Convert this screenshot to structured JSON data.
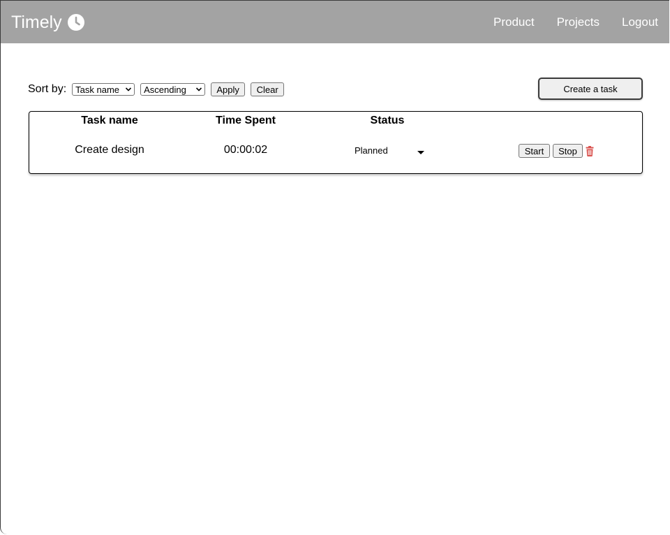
{
  "nav": {
    "brand": "Timely",
    "links": [
      "Product",
      "Projects",
      "Logout"
    ]
  },
  "toolbar": {
    "sort_label": "Sort by:",
    "sort_field": "Task name",
    "sort_order": "Ascending",
    "apply": "Apply",
    "clear": "Clear",
    "create": "Create a task"
  },
  "table": {
    "headers": [
      "Task name",
      "Time Spent",
      "Status"
    ],
    "rows": [
      {
        "name": "Create design",
        "time": "00:00:02",
        "status": "Planned",
        "start": "Start",
        "stop": "Stop"
      }
    ]
  },
  "icons": {
    "brand": "clock-icon",
    "delete": "trash-icon"
  },
  "colors": {
    "navbar": "#a3a3a3",
    "delete": "#d9534f"
  }
}
